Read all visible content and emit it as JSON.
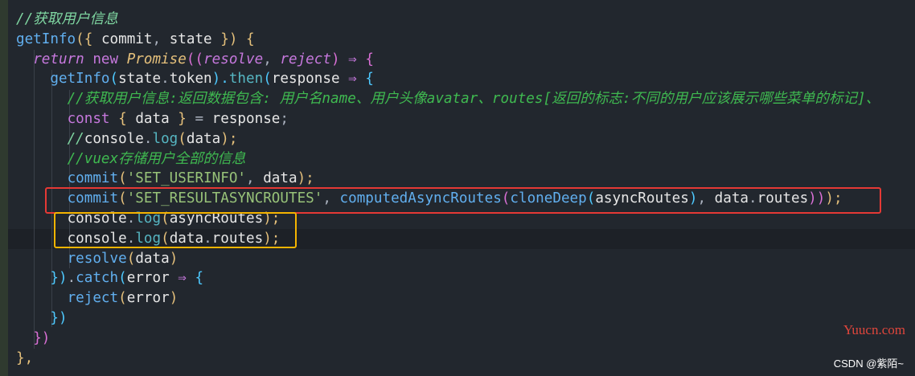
{
  "lines": [
    {
      "tokens": [
        {
          "t": "//获取用户信息",
          "c": "cmt"
        }
      ]
    },
    {
      "tokens": [
        {
          "t": "getInfo",
          "c": "fn"
        },
        {
          "t": "({ ",
          "c": "brace1"
        },
        {
          "t": "commit",
          "c": "var"
        },
        {
          "t": ", ",
          "c": "punc"
        },
        {
          "t": "state",
          "c": "var"
        },
        {
          "t": " }) {",
          "c": "brace1"
        }
      ]
    },
    {
      "tokens": [
        {
          "t": "  ",
          "c": "punc"
        },
        {
          "t": "return",
          "c": "kw"
        },
        {
          "t": " ",
          "c": "punc"
        },
        {
          "t": "new",
          "c": "kw2"
        },
        {
          "t": " ",
          "c": "punc"
        },
        {
          "t": "Promise",
          "c": "prm2"
        },
        {
          "t": "((",
          "c": "brace2"
        },
        {
          "t": "resolve",
          "c": "kw"
        },
        {
          "t": ", ",
          "c": "punc"
        },
        {
          "t": "reject",
          "c": "kw"
        },
        {
          "t": ") ",
          "c": "brace2"
        },
        {
          "t": "⇒",
          "c": "op"
        },
        {
          "t": " {",
          "c": "brace2"
        }
      ]
    },
    {
      "tokens": [
        {
          "t": "    ",
          "c": "punc"
        },
        {
          "t": "getInfo",
          "c": "fn"
        },
        {
          "t": "(",
          "c": "brace3"
        },
        {
          "t": "state",
          "c": "var"
        },
        {
          "t": ".",
          "c": "punc"
        },
        {
          "t": "token",
          "c": "var"
        },
        {
          "t": ").",
          "c": "brace3"
        },
        {
          "t": "then",
          "c": "fn2"
        },
        {
          "t": "(",
          "c": "brace3"
        },
        {
          "t": "response",
          "c": "var"
        },
        {
          "t": " ",
          "c": "punc"
        },
        {
          "t": "⇒",
          "c": "op"
        },
        {
          "t": " {",
          "c": "brace3"
        }
      ]
    },
    {
      "tokens": [
        {
          "t": "      ",
          "c": "punc"
        },
        {
          "t": "//获取用户信息:返回数据包含: 用户名name、用户头像avatar、routes[返回的标志:不同的用户应该展示哪些菜单的标记]、",
          "c": "cmt2"
        }
      ]
    },
    {
      "tokens": [
        {
          "t": "      ",
          "c": "punc"
        },
        {
          "t": "const",
          "c": "kw2"
        },
        {
          "t": " { ",
          "c": "brace1"
        },
        {
          "t": "data",
          "c": "var"
        },
        {
          "t": " } ",
          "c": "brace1"
        },
        {
          "t": "=",
          "c": "punc"
        },
        {
          "t": " ",
          "c": "punc"
        },
        {
          "t": "response",
          "c": "var"
        },
        {
          "t": ";",
          "c": "punc"
        }
      ]
    },
    {
      "tokens": [
        {
          "t": "      ",
          "c": "punc"
        },
        {
          "t": "//",
          "c": "cmt"
        },
        {
          "t": "console",
          "c": "var"
        },
        {
          "t": ".",
          "c": "punc"
        },
        {
          "t": "log",
          "c": "fn2"
        },
        {
          "t": "(",
          "c": "brace1"
        },
        {
          "t": "data",
          "c": "var"
        },
        {
          "t": ");",
          "c": "brace1"
        }
      ]
    },
    {
      "tokens": [
        {
          "t": "      ",
          "c": "punc"
        },
        {
          "t": "//vuex存储用户全部的信息",
          "c": "cmt2"
        }
      ]
    },
    {
      "tokens": [
        {
          "t": "      ",
          "c": "punc"
        },
        {
          "t": "commit",
          "c": "fn"
        },
        {
          "t": "(",
          "c": "brace1"
        },
        {
          "t": "'SET_USERINFO'",
          "c": "str"
        },
        {
          "t": ", ",
          "c": "punc"
        },
        {
          "t": "data",
          "c": "var"
        },
        {
          "t": ");",
          "c": "brace1"
        }
      ]
    },
    {
      "tokens": [
        {
          "t": "      ",
          "c": "punc"
        },
        {
          "t": "commit",
          "c": "fn"
        },
        {
          "t": "(",
          "c": "brace1"
        },
        {
          "t": "'SET_RESULTASYNCROUTES'",
          "c": "str"
        },
        {
          "t": ", ",
          "c": "punc"
        },
        {
          "t": "computedAsyncRoutes",
          "c": "fn"
        },
        {
          "t": "(",
          "c": "brace2"
        },
        {
          "t": "cloneDeep",
          "c": "fn"
        },
        {
          "t": "(",
          "c": "brace3"
        },
        {
          "t": "asyncRoutes",
          "c": "var"
        },
        {
          "t": ")",
          "c": "brace3"
        },
        {
          "t": ", ",
          "c": "punc"
        },
        {
          "t": "data",
          "c": "var"
        },
        {
          "t": ".",
          "c": "punc"
        },
        {
          "t": "routes",
          "c": "var"
        },
        {
          "t": "))",
          "c": "brace2"
        },
        {
          "t": ");",
          "c": "brace1"
        }
      ]
    },
    {
      "tokens": [
        {
          "t": "      ",
          "c": "punc"
        },
        {
          "t": "console",
          "c": "var"
        },
        {
          "t": ".",
          "c": "punc"
        },
        {
          "t": "log",
          "c": "fn2"
        },
        {
          "t": "(",
          "c": "brace1"
        },
        {
          "t": "asyncRoutes",
          "c": "var"
        },
        {
          "t": ");",
          "c": "brace1"
        }
      ]
    },
    {
      "tokens": [
        {
          "t": "      ",
          "c": "punc"
        },
        {
          "t": "console",
          "c": "var"
        },
        {
          "t": ".",
          "c": "punc"
        },
        {
          "t": "log",
          "c": "fn2"
        },
        {
          "t": "(",
          "c": "brace1"
        },
        {
          "t": "data",
          "c": "var"
        },
        {
          "t": ".",
          "c": "punc"
        },
        {
          "t": "routes",
          "c": "var"
        },
        {
          "t": ");",
          "c": "brace1"
        }
      ]
    },
    {
      "tokens": [
        {
          "t": "      ",
          "c": "punc"
        },
        {
          "t": "resolve",
          "c": "fn"
        },
        {
          "t": "(",
          "c": "brace1"
        },
        {
          "t": "data",
          "c": "var"
        },
        {
          "t": ")",
          "c": "brace1"
        }
      ]
    },
    {
      "tokens": [
        {
          "t": "    ",
          "c": "punc"
        },
        {
          "t": "})",
          "c": "brace3"
        },
        {
          "t": ".",
          "c": "punc"
        },
        {
          "t": "catch",
          "c": "fn"
        },
        {
          "t": "(",
          "c": "brace3"
        },
        {
          "t": "error",
          "c": "var"
        },
        {
          "t": " ",
          "c": "punc"
        },
        {
          "t": "⇒",
          "c": "op"
        },
        {
          "t": " {",
          "c": "brace3"
        }
      ]
    },
    {
      "tokens": [
        {
          "t": "      ",
          "c": "punc"
        },
        {
          "t": "reject",
          "c": "fn"
        },
        {
          "t": "(",
          "c": "brace1"
        },
        {
          "t": "error",
          "c": "var"
        },
        {
          "t": ")",
          "c": "brace1"
        }
      ]
    },
    {
      "tokens": [
        {
          "t": "    ",
          "c": "punc"
        },
        {
          "t": "})",
          "c": "brace3"
        }
      ]
    },
    {
      "tokens": [
        {
          "t": "  ",
          "c": "punc"
        },
        {
          "t": "})",
          "c": "brace2"
        }
      ]
    },
    {
      "tokens": [
        {
          "t": "},",
          "c": "brace1"
        }
      ]
    }
  ],
  "watermark": {
    "site": "Yuucn.com",
    "credit": "CSDN @紫陌~"
  }
}
